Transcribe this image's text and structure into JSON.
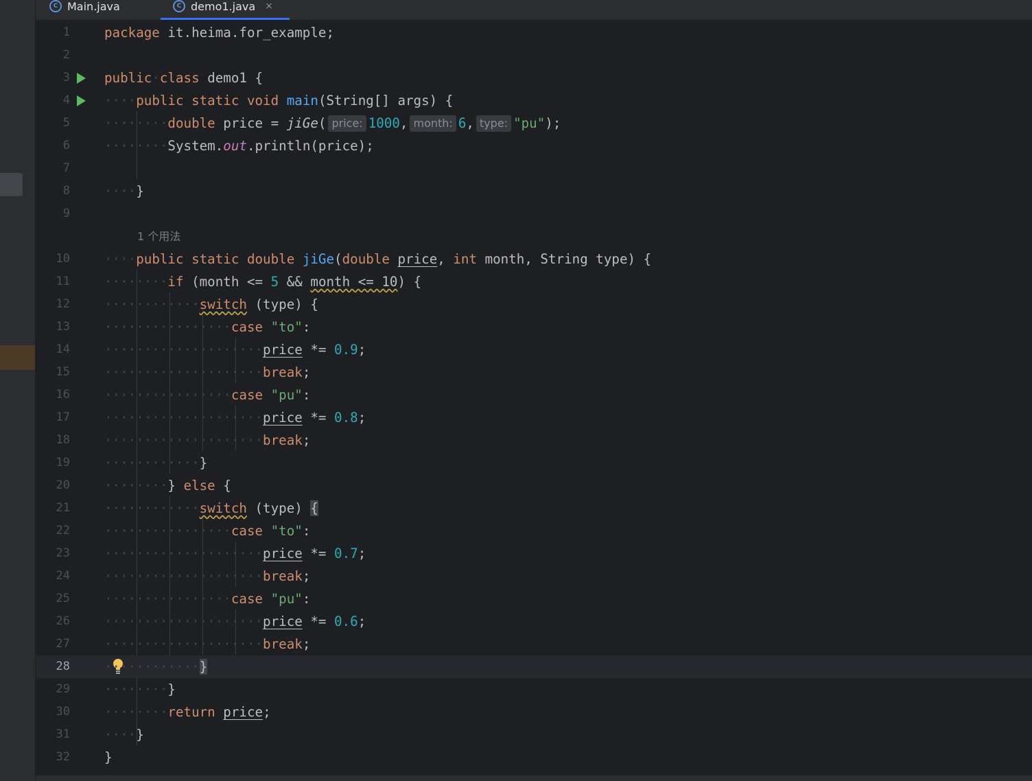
{
  "tabs": [
    {
      "label": "Main.java",
      "icon": "java-class-icon",
      "active": false
    },
    {
      "label": "demo1.java",
      "icon": "java-class-icon",
      "active": true
    }
  ],
  "tab_close_glyph": "×",
  "usage_hint": "1 个用法",
  "code": {
    "l1": {
      "no": "1",
      "package_kw": "package",
      "rest": " it.heima.for_example;"
    },
    "l3": {
      "no": "3",
      "public_kw": "public",
      "class_kw": "class",
      "name": " demo1 {"
    },
    "l4": {
      "no": "4",
      "mods": "public static void",
      "fn": "main",
      "rest": "(String[] args) {"
    },
    "l5": {
      "no": "5",
      "type_kw": "double",
      "mid": " price = ",
      "fn": "jiGe",
      "open": "(",
      "hint1": "price:",
      "v1": "1000",
      "hint2": "month:",
      "v2": "6",
      "hint3": "type:",
      "v3": "\"pu\"",
      "close": ");"
    },
    "l6": {
      "no": "6",
      "pre": "System.",
      "field": "out",
      "rest": ".println(price);"
    },
    "l8": {
      "no": "8",
      "text": "}"
    },
    "l10": {
      "no": "10",
      "mods": "public static double",
      "fn": "jiGe",
      "p0": "(",
      "t1": "double",
      "a1": "price",
      "c1": ", ",
      "t2": "int",
      "a2": " month, String type) {"
    },
    "l11": {
      "no": "11",
      "kw": "if",
      "t1": " (month <= ",
      "n1": "5",
      "t2": " && ",
      "w": "month <= 10",
      "t3": ") {"
    },
    "l12": {
      "no": "12",
      "kw": "switch",
      "rest": " (type) {"
    },
    "l13": {
      "no": "13",
      "kw": "case",
      "str": "\"to\"",
      "rest": ":"
    },
    "l14": {
      "no": "14",
      "var": "price",
      "op": " *= ",
      "num": "0.9",
      "end": ";"
    },
    "l15": {
      "no": "15",
      "kw": "break",
      "end": ";"
    },
    "l16": {
      "no": "16",
      "kw": "case",
      "str": "\"pu\"",
      "rest": ":"
    },
    "l17": {
      "no": "17",
      "var": "price",
      "op": " *= ",
      "num": "0.8",
      "end": ";"
    },
    "l18": {
      "no": "18",
      "kw": "break",
      "end": ";"
    },
    "l19": {
      "no": "19",
      "text": "}"
    },
    "l20": {
      "no": "20",
      "b": "} ",
      "kw": "else",
      "rest": " {"
    },
    "l21": {
      "no": "21",
      "kw": "switch",
      "rest": " (type) ",
      "brace": "{"
    },
    "l22": {
      "no": "22",
      "kw": "case",
      "str": "\"to\"",
      "rest": ":"
    },
    "l23": {
      "no": "23",
      "var": "price",
      "op": " *= ",
      "num": "0.7",
      "end": ";"
    },
    "l24": {
      "no": "24",
      "kw": "break",
      "end": ";"
    },
    "l25": {
      "no": "25",
      "kw": "case",
      "str": "\"pu\"",
      "rest": ":"
    },
    "l26": {
      "no": "26",
      "var": "price",
      "op": " *= ",
      "num": "0.6",
      "end": ";"
    },
    "l27": {
      "no": "27",
      "kw": "break",
      "end": ";"
    },
    "l28": {
      "no": "28",
      "text": "}"
    },
    "l29": {
      "no": "29",
      "text": "}"
    },
    "l30": {
      "no": "30",
      "kw": "return",
      "var": "price",
      "end": ";"
    },
    "l31": {
      "no": "31",
      "text": "}"
    },
    "l32": {
      "no": "32",
      "text": "}"
    },
    "empty": {
      "l2": "2",
      "l7": "7",
      "l9": "9"
    }
  }
}
